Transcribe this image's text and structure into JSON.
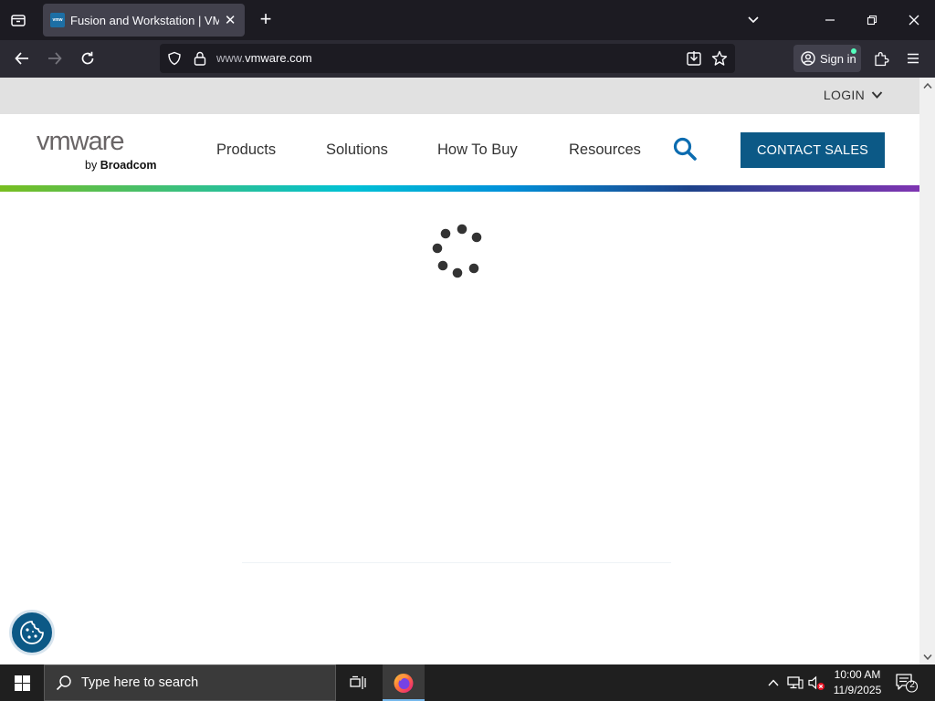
{
  "browser": {
    "tab": {
      "favicon_text": "vmw",
      "title": "Fusion and Workstation | VMware"
    },
    "url": {
      "prefix": "www.",
      "domain": "vmware.com"
    },
    "signin_label": "Sign in"
  },
  "site": {
    "utility": {
      "login_label": "LOGIN"
    },
    "logo": {
      "wordmark": "vmware",
      "by": "by",
      "brand": "Broadcom"
    },
    "nav": [
      {
        "label": "Products"
      },
      {
        "label": "Solutions"
      },
      {
        "label": "How To Buy"
      },
      {
        "label": "Resources"
      }
    ],
    "contact_label": "CONTACT SALES",
    "accent_colors": {
      "brand_blue": "#0c5986",
      "gradient": [
        "#78be20",
        "#00c1d5",
        "#0091da",
        "#1d428a",
        "#7f35b2"
      ]
    },
    "loading_indicator": "spinner-icon",
    "cookie_button_icon": "cookie-icon"
  },
  "taskbar": {
    "search_placeholder": "Type here to search",
    "time": "10:00 AM",
    "date": "11/9/2025",
    "notification_count": "2"
  }
}
